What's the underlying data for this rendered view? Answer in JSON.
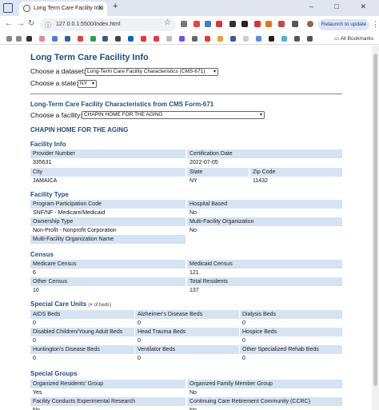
{
  "browser": {
    "tab_title": "Long Term Care Facility Info",
    "url": "127.0.0.1:5500/index.html",
    "relaunch_label": "Relaunch to update",
    "all_bookmarks_label": "All Bookmarks",
    "window_controls": "– □ ✕",
    "icons": [
      "back-arrow-icon",
      "forward-arrow-icon",
      "reload-icon",
      "info-icon",
      "star-icon",
      "menu-icon"
    ]
  },
  "page": {
    "title": "Long Term Care Facility Info",
    "dataset_label": "Choose a dataset:",
    "dataset_value": "Long-Term Care Facility Characteristics (CMS-671)",
    "state_label": "Choose a state:",
    "state_value": "NY",
    "section_title": "Long-Term Care Facility Characteristics from CMS Form-671",
    "facility_label": "Choose a facility:",
    "facility_value": "CHAPIN HOME FOR THE AGING",
    "facility_name": "CHAPIN HOME FOR THE AGING"
  },
  "facility_info": {
    "title": "Facility Info",
    "provider_number_label": "Provider Number",
    "provider_number": "335631",
    "certification_date_label": "Certification Date",
    "certification_date": "2022-07-05",
    "city_label": "City",
    "city": "JAMAICA",
    "state_label": "State",
    "state": "NY",
    "zip_label": "Zip Code",
    "zip": "11432"
  },
  "facility_type": {
    "title": "Facility Type",
    "program_label": "Program Participation Code",
    "program": "SNF/NF - Medicare/Medicaid",
    "hospital_based_label": "Hospital Based",
    "hospital_based": "No",
    "ownership_label": "Ownership Type",
    "ownership": "Non-Profit - Nonprofit Corporation",
    "multi_facility_label": "Multi-Facility Organization",
    "multi_facility": "No",
    "multi_facility_name_label": "Multi-Facility Organization Name",
    "multi_facility_name": ""
  },
  "census": {
    "title": "Census",
    "medicare_label": "Medicare Census",
    "medicare": "6",
    "medicaid_label": "Medicaid Census",
    "medicaid": "121",
    "other_label": "Other Census",
    "other": "10",
    "total_label": "Total Residents",
    "total": "137"
  },
  "special_care": {
    "title": "Special Care Units",
    "subtitle": "(# of beds)",
    "aids_label": "AIDS Beds",
    "aids": "0",
    "alzheimers_label": "Alzheimer's Disease Beds",
    "alzheimers": "0",
    "dialysis_label": "Dialysis Beds",
    "dialysis": "0",
    "disabled_label": "Disabled Children/Young Adult Beds",
    "disabled": "0",
    "head_trauma_label": "Head Trauma Beds",
    "head_trauma": "0",
    "hospice_label": "Hospice Beds",
    "hospice": "0",
    "huntington_label": "Huntington's Disease Beds",
    "huntington": "0",
    "ventilator_label": "Ventilator Beds",
    "ventilator": "0",
    "other_rehab_label": "Other Specialized Rehab Beds",
    "other_rehab": "0"
  },
  "special_groups": {
    "title": "Special Groups",
    "residents_group_label": "Organized Residents' Group",
    "residents_group": "Yes",
    "family_group_label": "Organized Family Member Group",
    "family_group": "No",
    "experimental_label": "Facility Conducts Experimental Research",
    "experimental": "No",
    "ccrc_label": "Continuing Care Retirement Community (CCRC)",
    "ccrc": "No"
  }
}
